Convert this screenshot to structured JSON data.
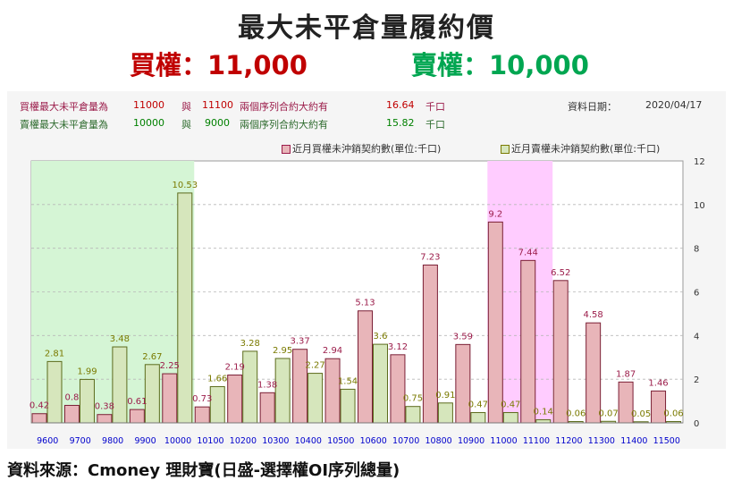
{
  "header": {
    "title": "最大未平倉量履約價",
    "call_label": "買權：11,000",
    "put_label": "賣權：10,000"
  },
  "info": {
    "call": {
      "prefix": "買權最大未平倉量為",
      "strike_a": "11000",
      "conj": "與",
      "strike_b": "11100",
      "text": "兩個序列合約大約有",
      "value": "16.64",
      "unit": "千口"
    },
    "put": {
      "prefix": "賣權最大未平倉量為",
      "strike_a": "10000",
      "conj": "與",
      "strike_b": "9000",
      "text": "兩個序列合約大約有",
      "value": "15.82",
      "unit": "千口"
    },
    "date_label": "資料日期：",
    "date_value": "2020/04/17"
  },
  "colors": {
    "call_bar": "#e8b5b9",
    "put_bar": "#d6e6bc",
    "call_text": "#9b1c4a",
    "put_text": "#7a7a00",
    "put_zone": "#d5f5d5",
    "call_zone": "#ffccff",
    "title_call": "#c00000",
    "title_put": "#00a651",
    "axis_label": "#0000cc"
  },
  "chart_data": {
    "type": "bar",
    "categories": [
      "9600",
      "9700",
      "9800",
      "9900",
      "10000",
      "10100",
      "10200",
      "10300",
      "10400",
      "10500",
      "10600",
      "10700",
      "10800",
      "10900",
      "11000",
      "11100",
      "11200",
      "11300",
      "11400",
      "11500"
    ],
    "series": [
      {
        "name": "近月買權未沖銷契約數(單位:千口)",
        "values": [
          0.42,
          0.8,
          0.38,
          0.61,
          2.25,
          0.73,
          2.19,
          1.38,
          3.37,
          2.94,
          5.13,
          3.12,
          7.23,
          3.59,
          9.2,
          7.44,
          6.52,
          4.58,
          1.87,
          1.46
        ]
      },
      {
        "name": "近月賣權未沖銷契約數(單位:千口)",
        "values": [
          2.81,
          1.99,
          3.48,
          2.67,
          10.53,
          1.66,
          3.28,
          2.95,
          2.27,
          1.54,
          3.6,
          0.75,
          0.91,
          0.47,
          0.47,
          0.14,
          0.06,
          0.07,
          0.05,
          0.06
        ]
      }
    ],
    "ylim": [
      0,
      12
    ],
    "yticks": [
      "0",
      "2",
      "4",
      "6",
      "8",
      "10",
      "12"
    ],
    "y_axis_side": "right",
    "grid": true,
    "legend_position": "top-right",
    "highlight_put_range": [
      "9600",
      "10000"
    ],
    "highlight_call_range": [
      "11000",
      "11100"
    ]
  },
  "footer": {
    "source": "資料來源：Cmoney 理財寶(日盛-選擇權OI序列總量)"
  }
}
